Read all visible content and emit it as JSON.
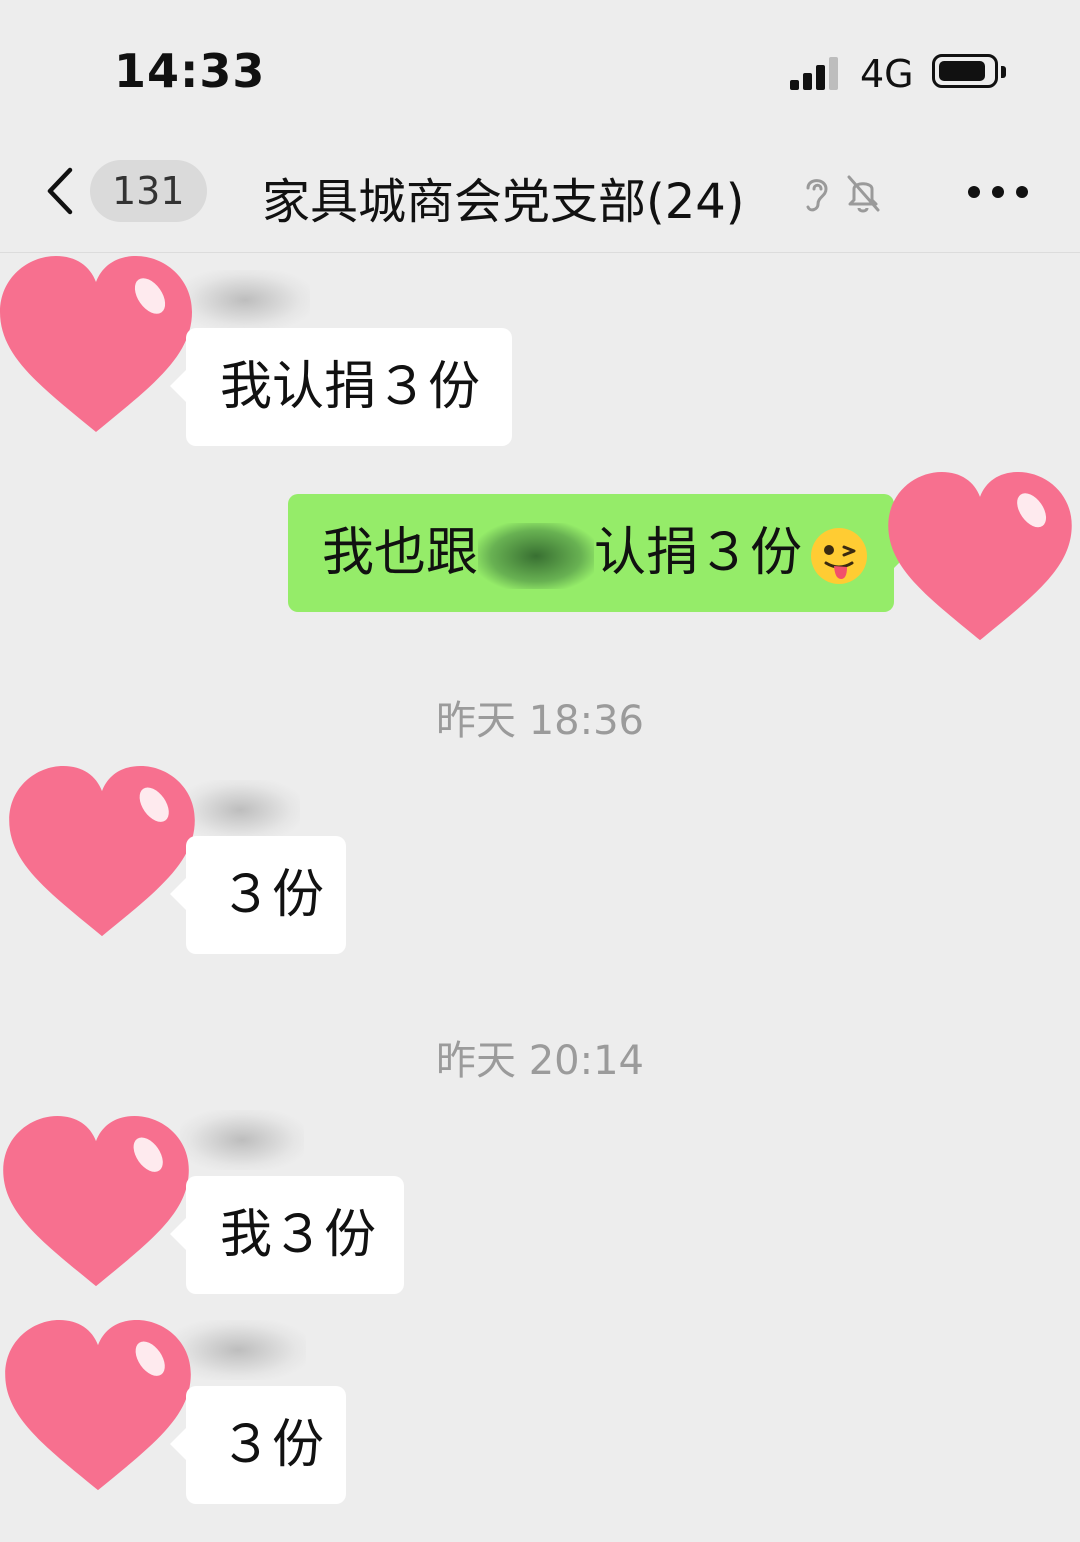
{
  "status_bar": {
    "time": "14:33",
    "network": "4G"
  },
  "nav": {
    "unread_count": "131",
    "title": "家具城商会党支部(24)"
  },
  "colors": {
    "background": "#ededed",
    "bubble_self": "#95ec69",
    "bubble_other": "#ffffff",
    "heart_sticker": "#f7708f"
  },
  "messages": [
    {
      "side": "left",
      "text": "我认捐３份"
    },
    {
      "side": "right",
      "text_before": "我也跟",
      "text_after": "认捐３份",
      "emoji": "winking-face-with-tongue"
    },
    {
      "type": "timestamp",
      "text": "昨天 18:36"
    },
    {
      "side": "left",
      "text": "３份"
    },
    {
      "type": "timestamp",
      "text": "昨天 20:14"
    },
    {
      "side": "left",
      "text": "我３份"
    },
    {
      "side": "left",
      "text": "３份"
    }
  ]
}
